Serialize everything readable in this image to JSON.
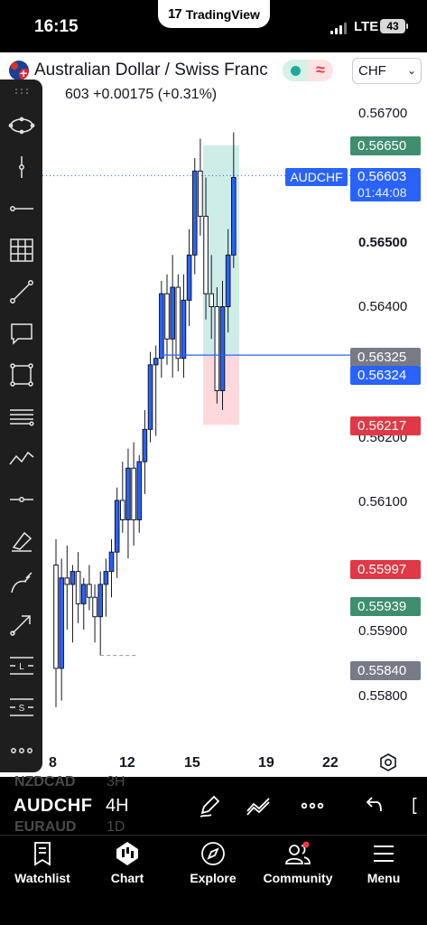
{
  "status_bar": {
    "time": "16:15",
    "app_pill": "TradingView",
    "network": "LTE",
    "battery": "43"
  },
  "header": {
    "symbol_title": "Australian Dollar / Swiss Franc",
    "currency": "CHF",
    "price_change_line": "603 +0.00175 (+0.31%)"
  },
  "chart": {
    "price_axis": [
      "0.56700",
      "0.56500",
      "0.56400",
      "0.56200",
      "0.56100",
      "0.55900",
      "0.55800"
    ],
    "price_axis_bold": "0.56500",
    "symbol_label": "AUDCHF",
    "current_price": "0.56603",
    "countdown": "01:44:08",
    "tags": {
      "target": "0.56650",
      "entry": "0.56325",
      "entry_blue": "0.56324",
      "stop": "0.56217",
      "red_level": "0.55997",
      "green_level": "0.55939",
      "gray_level": "0.55840"
    },
    "x_axis": [
      "8",
      "12",
      "15",
      "19",
      "22"
    ]
  },
  "chart_data": {
    "type": "candlestick",
    "symbol": "AUDCHF",
    "timeframe": "4H",
    "ylim": [
      0.5576,
      0.5673
    ],
    "x_ticks": [
      "8",
      "12",
      "15",
      "19",
      "22"
    ],
    "candles": [
      {
        "o": 0.56,
        "h": 0.5604,
        "l": 0.5578,
        "c": 0.5584
      },
      {
        "o": 0.5584,
        "h": 0.5601,
        "l": 0.5579,
        "c": 0.5598
      },
      {
        "o": 0.5598,
        "h": 0.5603,
        "l": 0.559,
        "c": 0.5597
      },
      {
        "o": 0.5597,
        "h": 0.56,
        "l": 0.5588,
        "c": 0.5599
      },
      {
        "o": 0.5599,
        "h": 0.5602,
        "l": 0.5591,
        "c": 0.5594
      },
      {
        "o": 0.5594,
        "h": 0.5598,
        "l": 0.559,
        "c": 0.5597
      },
      {
        "o": 0.5597,
        "h": 0.56,
        "l": 0.5593,
        "c": 0.5595
      },
      {
        "o": 0.5595,
        "h": 0.5597,
        "l": 0.5588,
        "c": 0.5592
      },
      {
        "o": 0.5592,
        "h": 0.5599,
        "l": 0.5586,
        "c": 0.5597
      },
      {
        "o": 0.5597,
        "h": 0.5601,
        "l": 0.5592,
        "c": 0.5599
      },
      {
        "o": 0.5599,
        "h": 0.5604,
        "l": 0.5595,
        "c": 0.5602
      },
      {
        "o": 0.5602,
        "h": 0.5612,
        "l": 0.5598,
        "c": 0.561
      },
      {
        "o": 0.561,
        "h": 0.5616,
        "l": 0.5605,
        "c": 0.5607
      },
      {
        "o": 0.5607,
        "h": 0.5618,
        "l": 0.5601,
        "c": 0.5615
      },
      {
        "o": 0.5615,
        "h": 0.5619,
        "l": 0.5603,
        "c": 0.5607
      },
      {
        "o": 0.5607,
        "h": 0.5617,
        "l": 0.5605,
        "c": 0.5616
      },
      {
        "o": 0.5616,
        "h": 0.5624,
        "l": 0.5611,
        "c": 0.5621
      },
      {
        "o": 0.5621,
        "h": 0.5633,
        "l": 0.5619,
        "c": 0.5631
      },
      {
        "o": 0.5631,
        "h": 0.5634,
        "l": 0.562,
        "c": 0.5632
      },
      {
        "o": 0.5632,
        "h": 0.5644,
        "l": 0.5629,
        "c": 0.5642
      },
      {
        "o": 0.5642,
        "h": 0.5645,
        "l": 0.5631,
        "c": 0.5635
      },
      {
        "o": 0.5635,
        "h": 0.5648,
        "l": 0.5629,
        "c": 0.5643
      },
      {
        "o": 0.5643,
        "h": 0.5645,
        "l": 0.563,
        "c": 0.5632
      },
      {
        "o": 0.5632,
        "h": 0.5645,
        "l": 0.5629,
        "c": 0.5641
      },
      {
        "o": 0.5641,
        "h": 0.5652,
        "l": 0.5637,
        "c": 0.5648
      },
      {
        "o": 0.5648,
        "h": 0.5663,
        "l": 0.5645,
        "c": 0.5661
      },
      {
        "o": 0.5661,
        "h": 0.5666,
        "l": 0.5651,
        "c": 0.5654
      },
      {
        "o": 0.5654,
        "h": 0.566,
        "l": 0.5638,
        "c": 0.5642
      },
      {
        "o": 0.5642,
        "h": 0.5648,
        "l": 0.5635,
        "c": 0.564
      },
      {
        "o": 0.564,
        "h": 0.5643,
        "l": 0.5625,
        "c": 0.5627
      },
      {
        "o": 0.5627,
        "h": 0.5644,
        "l": 0.5624,
        "c": 0.564
      },
      {
        "o": 0.564,
        "h": 0.5652,
        "l": 0.5636,
        "c": 0.5648
      },
      {
        "o": 0.5648,
        "h": 0.5667,
        "l": 0.5646,
        "c": 0.566
      }
    ],
    "position": {
      "entry": 0.56325,
      "target": 0.5665,
      "stop": 0.56217
    },
    "current_price": 0.56603
  },
  "bottom_strip": {
    "symbol": "AUDCHF",
    "timeframe": "4H",
    "ghost_symbols": [
      "NZDCAD",
      "EURAUD"
    ],
    "ghost_timeframes": [
      "3H",
      "1D"
    ]
  },
  "nav": {
    "watchlist": "Watchlist",
    "chart": "Chart",
    "explore": "Explore",
    "community": "Community",
    "menu": "Menu"
  },
  "colors": {
    "bull": "#2962ff",
    "body_bull": "#2962ff",
    "outline": "#131722",
    "profit": "#22ab94",
    "loss": "#f7525f",
    "current_line": "#2962ff"
  }
}
